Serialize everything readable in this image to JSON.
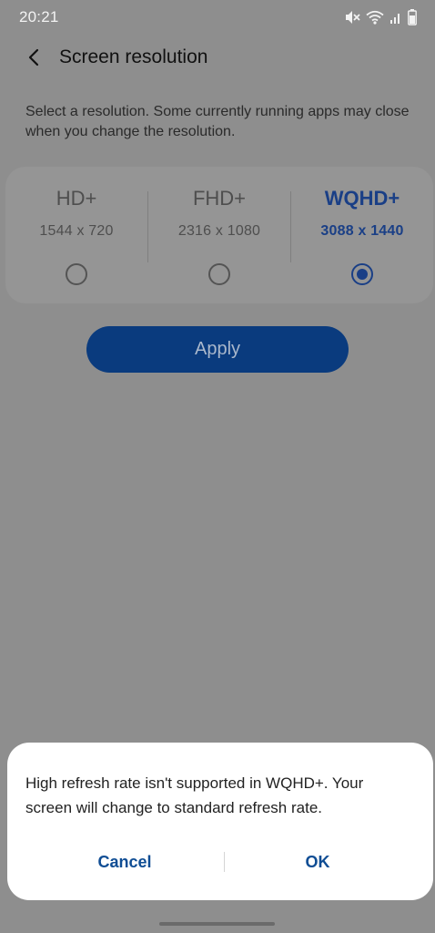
{
  "status_bar": {
    "time": "20:21",
    "icons": [
      "mute-icon",
      "wifi-icon",
      "signal-icon",
      "battery-icon"
    ]
  },
  "header": {
    "back_icon": "chevron-left-icon",
    "title": "Screen resolution"
  },
  "description": "Select a resolution. Some currently running apps may close when you change the resolution.",
  "resolutions": [
    {
      "name": "HD+",
      "value": "1544 x 720",
      "selected": false
    },
    {
      "name": "FHD+",
      "value": "2316 x 1080",
      "selected": false
    },
    {
      "name": "WQHD+",
      "value": "3088 x 1440",
      "selected": true
    }
  ],
  "apply_label": "Apply",
  "dialog": {
    "message": "High refresh rate isn't supported in WQHD+. Your screen will change to standard refresh rate.",
    "cancel_label": "Cancel",
    "ok_label": "OK"
  },
  "colors": {
    "accent": "#1a3f86",
    "apply_button": "#0a3b7e",
    "dim_overlay": "#8e8e8e",
    "dialog_button_text": "#0f4d94"
  }
}
